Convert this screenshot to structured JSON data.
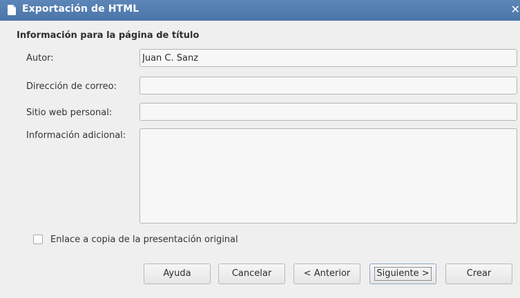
{
  "window": {
    "title": "Exportación de HTML",
    "close_glyph": "✕"
  },
  "section": {
    "heading": "Información para la página de título"
  },
  "fields": {
    "author": {
      "label": "Autor:",
      "value": "Juan C. Sanz"
    },
    "email": {
      "label": "Dirección de correo:",
      "value": ""
    },
    "website": {
      "label": "Sitio web personal:",
      "value": ""
    },
    "additional": {
      "label": "Información adicional:",
      "value": ""
    }
  },
  "checkbox": {
    "label": "Enlace a copia de la presentación original",
    "checked": false
  },
  "buttons": {
    "help": "Ayuda",
    "cancel": "Cancelar",
    "back": "< Anterior",
    "next": "Siguiente >",
    "create": "Crear"
  },
  "icons": {
    "title_icon": "document-icon",
    "close_icon": "close-icon"
  },
  "colors": {
    "titlebar": "#4f79ab",
    "background": "#efefef"
  }
}
